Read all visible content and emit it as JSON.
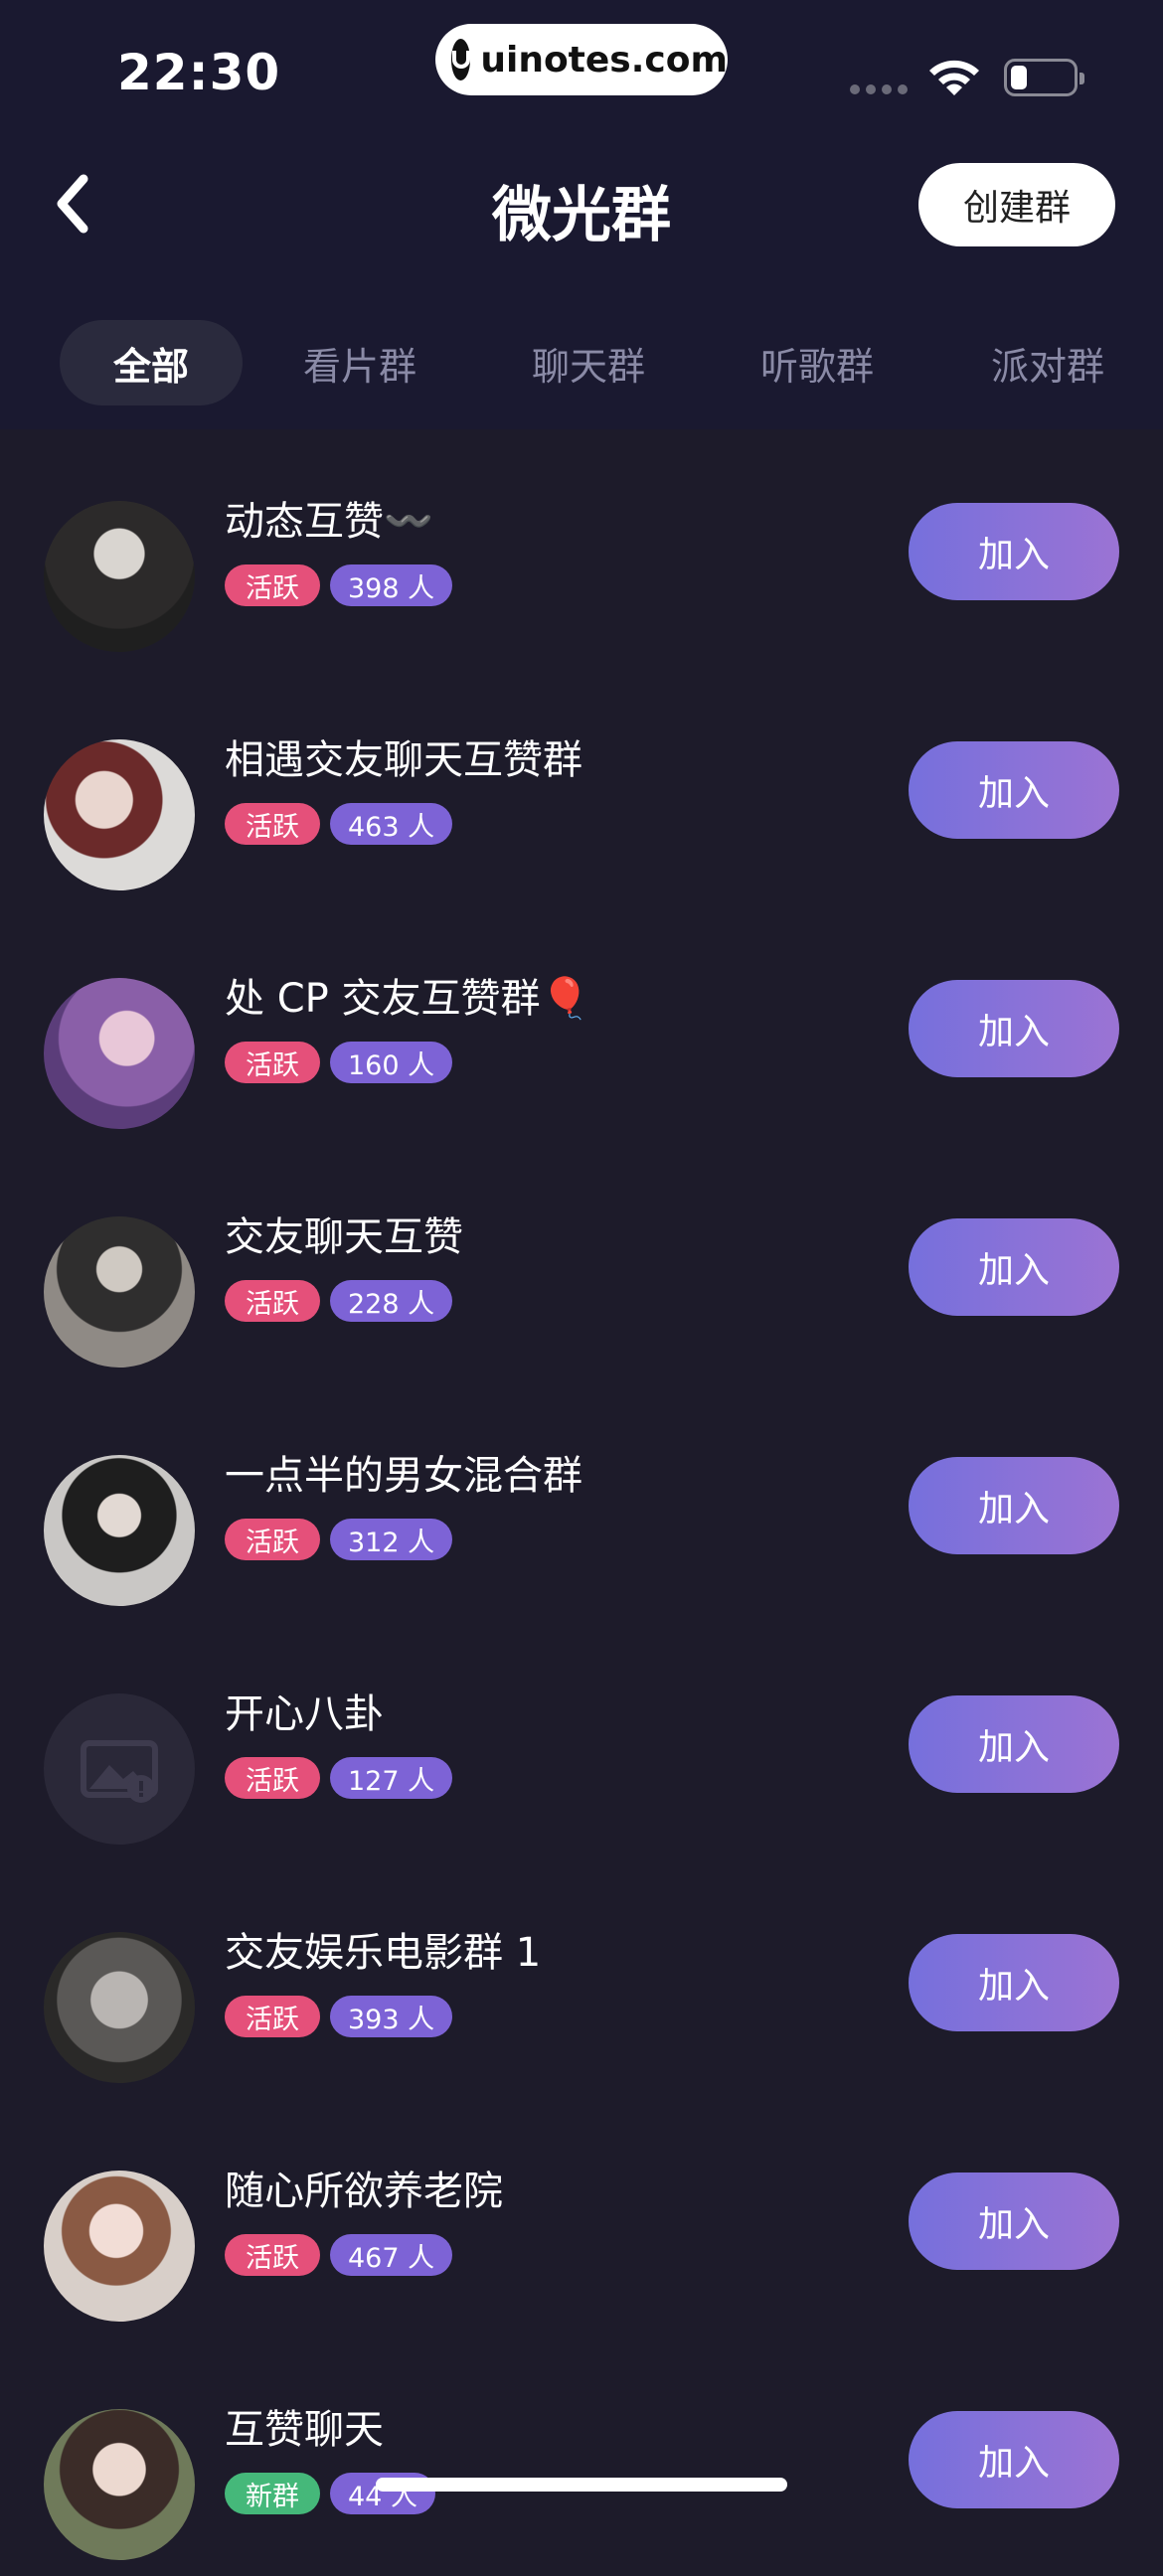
{
  "status_bar": {
    "time": "22:30",
    "watermark": "uinotes.com"
  },
  "nav": {
    "title": "微光群",
    "create_label": "创建群"
  },
  "tabs": [
    {
      "label": "全部",
      "active": true
    },
    {
      "label": "看片群",
      "active": false
    },
    {
      "label": "聊天群",
      "active": false
    },
    {
      "label": "听歌群",
      "active": false
    },
    {
      "label": "派对群",
      "active": false
    }
  ],
  "colors": {
    "tag_active": "#e5507a",
    "tag_new": "#45b87a",
    "tag_count": "#7d63d6",
    "join_gradient_start": "#7670dc",
    "join_gradient_end": "#9b73d4"
  },
  "groups": [
    {
      "name": "动态互赞〰️",
      "tag": "活跃",
      "count": "398 人",
      "join_label": "加入",
      "avatar": "photo"
    },
    {
      "name": "相遇交友聊天互赞群",
      "tag": "活跃",
      "count": "463 人",
      "join_label": "加入",
      "avatar": "photo"
    },
    {
      "name": "处 CP 交友互赞群🎈",
      "tag": "活跃",
      "count": "160 人",
      "join_label": "加入",
      "avatar": "photo"
    },
    {
      "name": "交友聊天互赞",
      "tag": "活跃",
      "count": "228 人",
      "join_label": "加入",
      "avatar": "photo"
    },
    {
      "name": "一点半的男女混合群",
      "tag": "活跃",
      "count": "312 人",
      "join_label": "加入",
      "avatar": "photo"
    },
    {
      "name": "开心八卦",
      "tag": "活跃",
      "count": "127 人",
      "join_label": "加入",
      "avatar": "broken-image-icon"
    },
    {
      "name": "交友娱乐电影群 1",
      "tag": "活跃",
      "count": "393 人",
      "join_label": "加入",
      "avatar": "photo"
    },
    {
      "name": "随心所欲养老院",
      "tag": "活跃",
      "count": "467 人",
      "join_label": "加入",
      "avatar": "photo"
    },
    {
      "name": "互赞聊天",
      "tag": "新群",
      "count": "44 人",
      "join_label": "加入",
      "avatar": "photo"
    }
  ]
}
